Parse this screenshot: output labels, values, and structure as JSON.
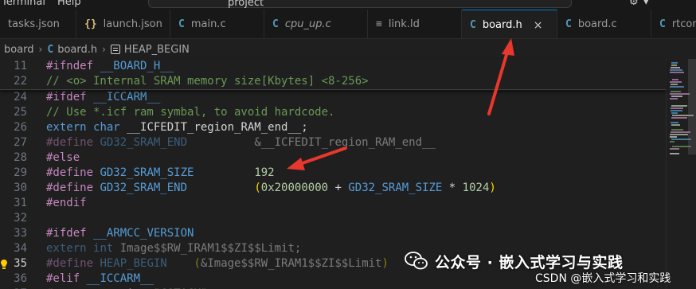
{
  "menu": {
    "items": [
      "Terminal",
      "Help"
    ],
    "command_center_text": "project"
  },
  "tabs": [
    {
      "icon": "{}",
      "icon_kind": "json",
      "label": "tasks.json",
      "active": false,
      "italic": false
    },
    {
      "icon": "{}",
      "icon_kind": "json",
      "label": "launch.json",
      "active": false,
      "italic": false
    },
    {
      "icon": "C",
      "icon_kind": "c",
      "label": "main.c",
      "active": false,
      "italic": false
    },
    {
      "icon": "C",
      "icon_kind": "c",
      "label": "cpu_up.c",
      "active": false,
      "italic": true
    },
    {
      "icon": "≡",
      "icon_kind": "ld",
      "label": "link.ld",
      "active": false,
      "italic": false
    },
    {
      "icon": "C",
      "icon_kind": "c",
      "label": "board.h",
      "active": true,
      "italic": false,
      "close": "×"
    },
    {
      "icon": "C",
      "icon_kind": "c",
      "label": "board.c",
      "active": false,
      "italic": false
    },
    {
      "icon": "C",
      "icon_kind": "c",
      "label": "rtconfig",
      "active": false,
      "italic": false
    }
  ],
  "breadcrumb": {
    "folder": "board",
    "file_icon": "C",
    "file": "board.h",
    "symbol": "HEAP_BEGIN"
  },
  "sticky_lines": [
    {
      "num": "11",
      "tokens": [
        [
          "kw",
          "#ifndef"
        ],
        [
          "plain",
          " "
        ],
        [
          "mac",
          "__BOARD_H__"
        ]
      ]
    },
    {
      "num": "22",
      "tokens": [
        [
          "com",
          "// <o> Internal SRAM memory size[Kbytes] <8-256>"
        ]
      ]
    }
  ],
  "lines": [
    {
      "num": "24",
      "tokens": [
        [
          "kw",
          "#ifdef"
        ],
        [
          "plain",
          " "
        ],
        [
          "mac",
          "__ICCARM__"
        ]
      ]
    },
    {
      "num": "25",
      "tokens": [
        [
          "com",
          "// Use *.icf ram symbal, to avoid hardcode."
        ]
      ]
    },
    {
      "num": "26",
      "tokens": [
        [
          "type",
          "extern"
        ],
        [
          "plain",
          " "
        ],
        [
          "type",
          "char"
        ],
        [
          "plain",
          " __ICFEDIT_region_RAM_end__;"
        ]
      ]
    },
    {
      "num": "27",
      "dim": true,
      "tokens": [
        [
          "kw",
          "#define"
        ],
        [
          "plain",
          " "
        ],
        [
          "mac",
          "GD32_SRAM_END"
        ],
        [
          "plain",
          "          &__ICFEDIT_region_RAM_end__"
        ]
      ]
    },
    {
      "num": "28",
      "tokens": [
        [
          "kw",
          "#else"
        ]
      ]
    },
    {
      "num": "29",
      "tokens": [
        [
          "kw",
          "#define"
        ],
        [
          "plain",
          " "
        ],
        [
          "mac",
          "GD32_SRAM_SIZE"
        ],
        [
          "plain",
          "         "
        ],
        [
          "num",
          "192"
        ]
      ]
    },
    {
      "num": "30",
      "tokens": [
        [
          "kw",
          "#define"
        ],
        [
          "plain",
          " "
        ],
        [
          "mac",
          "GD32_SRAM_END"
        ],
        [
          "plain",
          "          "
        ],
        [
          "paren",
          "("
        ],
        [
          "num",
          "0x20000000"
        ],
        [
          "plain",
          " + "
        ],
        [
          "mac",
          "GD32_SRAM_SIZE"
        ],
        [
          "plain",
          " * "
        ],
        [
          "num",
          "1024"
        ],
        [
          "paren",
          ")"
        ]
      ]
    },
    {
      "num": "31",
      "tokens": [
        [
          "kw",
          "#endif"
        ]
      ]
    },
    {
      "num": "32",
      "tokens": []
    },
    {
      "num": "33",
      "tokens": [
        [
          "kw",
          "#ifdef"
        ],
        [
          "plain",
          " "
        ],
        [
          "mac",
          "__ARMCC_VERSION"
        ]
      ]
    },
    {
      "num": "34",
      "dim": true,
      "tokens": [
        [
          "type",
          "extern"
        ],
        [
          "plain",
          " "
        ],
        [
          "type",
          "int"
        ],
        [
          "plain",
          " Image$$RW_IRAM1$$ZI$$Limit;"
        ]
      ]
    },
    {
      "num": "35",
      "current": true,
      "dim": true,
      "tokens": [
        [
          "kw",
          "#define"
        ],
        [
          "plain",
          " "
        ],
        [
          "mac",
          "HEAP_BEGIN"
        ],
        [
          "plain",
          "    "
        ],
        [
          "paren",
          "("
        ],
        [
          "plain",
          "&Image$$RW_IRAM1$$ZI$$Limit"
        ],
        [
          "paren",
          ")"
        ]
      ]
    },
    {
      "num": "36",
      "tokens": [
        [
          "kw",
          "#elif"
        ],
        [
          "plain",
          " "
        ],
        [
          "mac",
          "__ICCARM__"
        ]
      ]
    },
    {
      "num": "37",
      "dim": true,
      "tokens": [
        [
          "kw",
          "#pragma"
        ],
        [
          "plain",
          " section="
        ],
        [
          "num",
          "\"CSTACK\""
        ]
      ]
    }
  ],
  "watermark": {
    "text": "公众号 · 嵌入式学习与实践",
    "csdn": "CSDN @嵌入式学习和实践"
  },
  "colors": {
    "accent": "#0078d4",
    "annotation_arrow": "#e8372c"
  }
}
